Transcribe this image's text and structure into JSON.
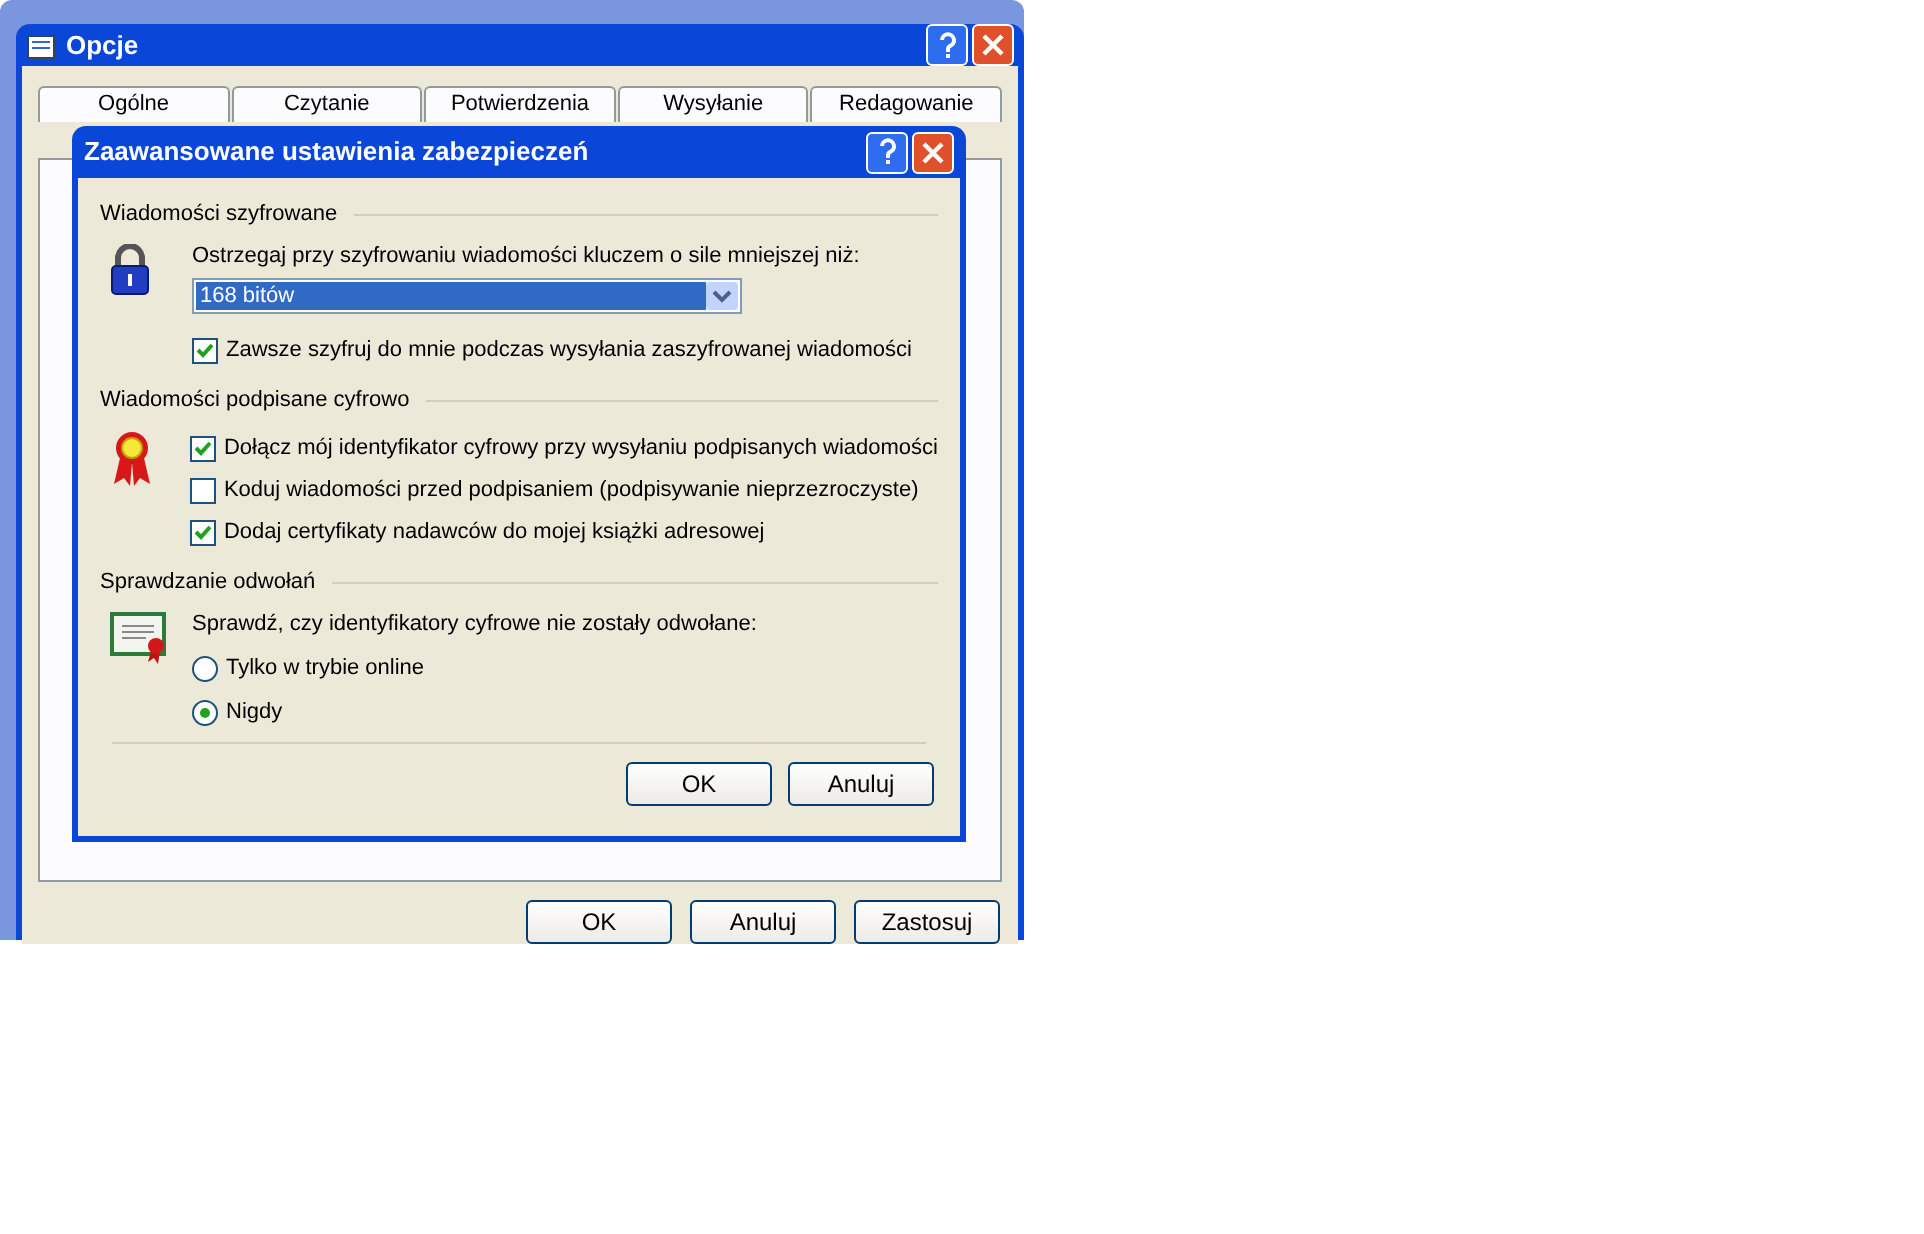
{
  "options_window": {
    "title": "Opcje",
    "tabs": [
      {
        "label": "Ogólne"
      },
      {
        "label": "Czytanie"
      },
      {
        "label": "Potwierdzenia"
      },
      {
        "label": "Wysyłanie"
      },
      {
        "label": "Redagowanie"
      }
    ],
    "buttons": [
      "OK",
      "Anuluj",
      "Zastosuj"
    ]
  },
  "dialog": {
    "title": "Zaawansowane ustawienia zabezpieczeń",
    "sections": [
      {
        "heading": "Wiadomości szyfrowane",
        "items": [
          {
            "kind": "label",
            "text": "Ostrzegaj przy szyfrowaniu wiadomości kluczem o sile mniejszej niż:"
          },
          {
            "kind": "select",
            "value": "168 bitów"
          },
          {
            "kind": "checkbox",
            "label": "Zawsze szyfruj do mnie podczas wysyłania zaszyfrowanej wiadomości",
            "checked": true
          }
        ]
      },
      {
        "heading": "Wiadomości podpisane cyfrowo",
        "items": [
          {
            "kind": "checkbox",
            "label": "Dołącz mój identyfikator cyfrowy przy wysyłaniu podpisanych wiadomości",
            "checked": true
          },
          {
            "kind": "checkbox",
            "label": "Koduj wiadomości przed podpisaniem (podpisywanie nieprzezroczyste)",
            "checked": false
          },
          {
            "kind": "checkbox",
            "label": "Dodaj certyfikaty nadawców do mojej książki adresowej",
            "checked": true
          }
        ]
      },
      {
        "heading": "Sprawdzanie odwołań",
        "items": [
          {
            "kind": "label",
            "text": "Sprawdź, czy identyfikatory cyfrowe nie zostały odwołane:"
          },
          {
            "kind": "radio",
            "label": "Tylko w trybie online",
            "selected": false
          },
          {
            "kind": "radio",
            "label": "Nigdy",
            "selected": true
          }
        ]
      }
    ],
    "buttons": [
      "OK",
      "Anuluj"
    ]
  }
}
